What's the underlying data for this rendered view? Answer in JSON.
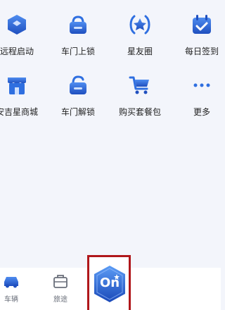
{
  "grid": {
    "row1": [
      {
        "label": "远程启动",
        "icon": "remote-start-icon"
      },
      {
        "label": "车门上锁",
        "icon": "door-lock-icon"
      },
      {
        "label": "星友圈",
        "icon": "star-circle-icon"
      },
      {
        "label": "每日签到",
        "icon": "calendar-check-icon"
      }
    ],
    "row2": [
      {
        "label": "安吉星商城",
        "icon": "store-icon"
      },
      {
        "label": "车门解锁",
        "icon": "door-unlock-icon"
      },
      {
        "label": "购买套餐包",
        "icon": "cart-icon"
      },
      {
        "label": "更多",
        "icon": "more-dots-icon"
      }
    ]
  },
  "tabbar": {
    "tabs": [
      {
        "label": "车辆",
        "icon": "car-icon"
      },
      {
        "label": "旅途",
        "icon": "bag-icon"
      }
    ],
    "center": {
      "text": "On",
      "icon": "onstar-hex-icon"
    }
  },
  "colors": {
    "accent": "#2f6fe0",
    "accent_dark": "#1f4fbf",
    "highlight_border": "#b0171b"
  }
}
